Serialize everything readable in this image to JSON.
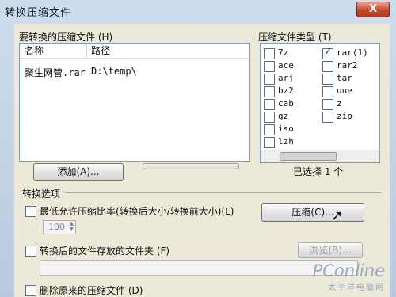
{
  "window": {
    "title": "转换压缩文件",
    "close_glyph": "X"
  },
  "files_section": {
    "label": "要转换的压缩文件 (H)",
    "columns": [
      "名称",
      "路径"
    ],
    "rows": [
      {
        "name": "聚生网管.rar",
        "path": "D:\\temp\\"
      }
    ],
    "add_button": "添加(A)..."
  },
  "types_section": {
    "label": "压缩文件类型 (T)",
    "left_items": [
      {
        "label": "7z",
        "checked": false
      },
      {
        "label": "ace",
        "checked": false
      },
      {
        "label": "arj",
        "checked": false
      },
      {
        "label": "bz2",
        "checked": false
      },
      {
        "label": "cab",
        "checked": false
      },
      {
        "label": "gz",
        "checked": false
      },
      {
        "label": "iso",
        "checked": false
      },
      {
        "label": "lzh",
        "checked": false
      }
    ],
    "right_items": [
      {
        "label": "rar(1)",
        "checked": true
      },
      {
        "label": "rar2",
        "checked": false
      },
      {
        "label": "tar",
        "checked": false
      },
      {
        "label": "uue",
        "checked": false
      },
      {
        "label": "z",
        "checked": false
      },
      {
        "label": "zip",
        "checked": false
      }
    ],
    "selected_count_text": "已选择 1 个"
  },
  "options": {
    "heading": "转换选项",
    "min_ratio_label": "最低允许压缩比率(转换后大小/转换前大小)(L)",
    "min_ratio_value": "100",
    "compress_button": "压缩(C)...",
    "save_folder_label": "转换后的文件存放的文件夹 (F)",
    "browse_button": "浏览(B)...",
    "delete_original_label": "删除原来的压缩文件 (D)"
  },
  "watermark": {
    "brand": "PConline",
    "sub": "太平洋电脑网"
  }
}
